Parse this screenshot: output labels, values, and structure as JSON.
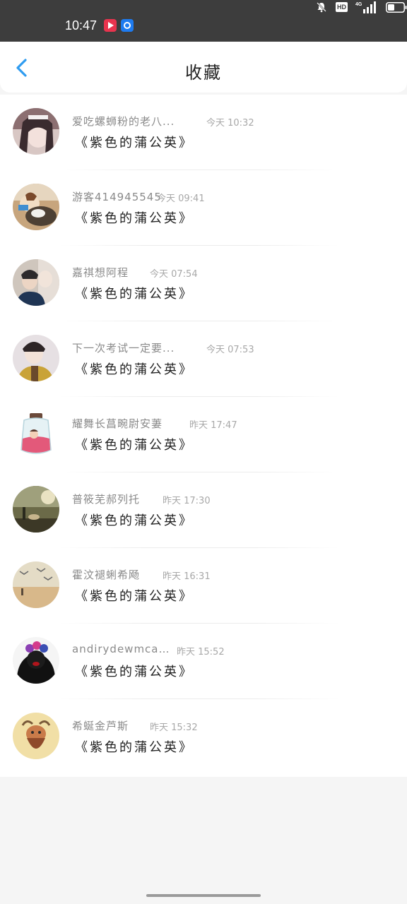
{
  "status_bar": {
    "time": "10:47",
    "hd_label": "HD",
    "network_label": "4G"
  },
  "header": {
    "title": "收藏",
    "back_icon": "chevron-left-icon",
    "accent_color": "#2f9cf0"
  },
  "favorites": [
    {
      "name": "爱吃螺蛳粉的老八...",
      "time": "今天 10:32",
      "work": "《紫色的蒲公英》",
      "avatar_icon": "avatar-girl-photo"
    },
    {
      "name": "游客414945545",
      "time": "今天 09:41",
      "work": "《紫色的蒲公英》",
      "avatar_icon": "avatar-dog-photo"
    },
    {
      "name": "嘉祺想阿程",
      "time": "今天 07:54",
      "work": "《紫色的蒲公英》",
      "avatar_icon": "avatar-couple-photo"
    },
    {
      "name": "下一次考试一定要...",
      "time": "今天 07:53",
      "work": "《紫色的蒲公英》",
      "avatar_icon": "avatar-boy-photo"
    },
    {
      "name": "耀舞长菖畹尉安萋",
      "time": "昨天 17:47",
      "work": "《紫色的蒲公英》",
      "avatar_icon": "avatar-jar-illustration"
    },
    {
      "name": "普筱芜郝列托",
      "time": "昨天 17:30",
      "work": "《紫色的蒲公英》",
      "avatar_icon": "avatar-landscape-photo"
    },
    {
      "name": "霍汶褪蜊希飏",
      "time": "昨天 16:31",
      "work": "《紫色的蒲公英》",
      "avatar_icon": "avatar-beach-photo"
    },
    {
      "name": "andirydewmcarcs",
      "time": "昨天 15:52",
      "work": "《紫色的蒲公英》",
      "avatar_icon": "avatar-dark-figure"
    },
    {
      "name": "希蜒金芦斯",
      "time": "昨天 15:32",
      "work": "《紫色的蒲公英》",
      "avatar_icon": "avatar-capricorn-illustration"
    }
  ]
}
